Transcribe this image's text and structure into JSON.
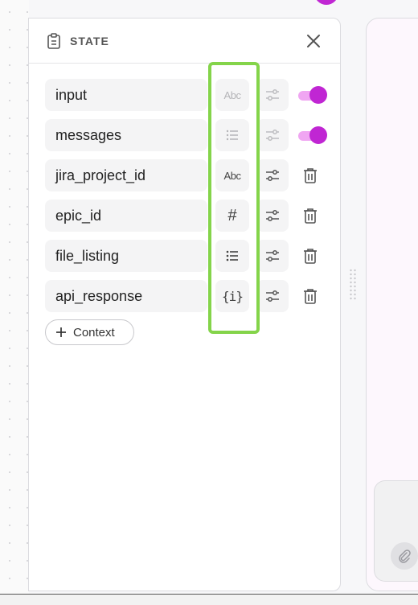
{
  "panel": {
    "title": "STATE",
    "icons": {
      "header": "clipboard-icon",
      "close": "close-icon"
    }
  },
  "state_fields": [
    {
      "name": "input",
      "type_icon": "text-type-icon",
      "type_glyph": "Abc",
      "dim": true,
      "control": "toggle",
      "enabled": true
    },
    {
      "name": "messages",
      "type_icon": "list-type-icon",
      "type_glyph": "",
      "dim": true,
      "control": "toggle",
      "enabled": true
    },
    {
      "name": "jira_project_id",
      "type_icon": "text-type-icon",
      "type_glyph": "Abc",
      "dim": false,
      "control": "delete"
    },
    {
      "name": "epic_id",
      "type_icon": "number-type-icon",
      "type_glyph": "#",
      "dim": false,
      "control": "delete"
    },
    {
      "name": "file_listing",
      "type_icon": "list-type-icon",
      "type_glyph": "",
      "dim": false,
      "control": "delete"
    },
    {
      "name": "api_response",
      "type_icon": "object-type-icon",
      "type_glyph": "{i}",
      "dim": false,
      "control": "delete"
    }
  ],
  "add_context": {
    "label": "Context",
    "icon": "plus-icon"
  },
  "colors": {
    "accent": "#c026d3",
    "toggle_track": "#f0a6f2",
    "highlight": "#84d44a"
  }
}
